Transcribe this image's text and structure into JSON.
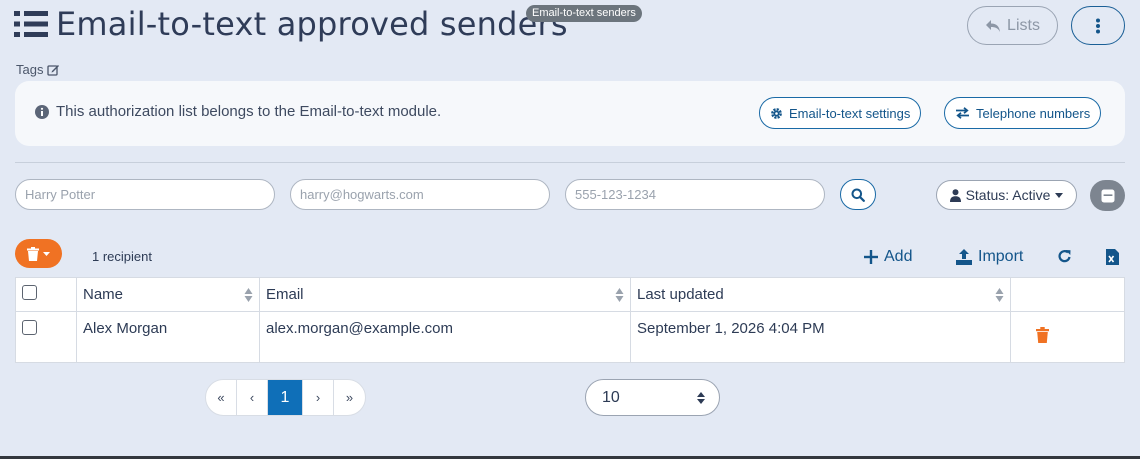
{
  "header": {
    "title": "Email-to-text approved senders",
    "module_badge": "Email-to-text senders",
    "lists_label": "Lists"
  },
  "tags_label": "Tags",
  "info": {
    "message": "This authorization list belongs to the Email-to-text module.",
    "settings_label": "Email-to-text settings",
    "numbers_label": "Telephone numbers"
  },
  "filters": {
    "name_placeholder": "Harry Potter",
    "email_placeholder": "harry@hogwarts.com",
    "phone_placeholder": "555-123-1234",
    "status_label": "Status: Active"
  },
  "toolbar": {
    "count": "1 recipient",
    "add_label": "Add",
    "import_label": "Import"
  },
  "table": {
    "headers": [
      "Name",
      "Email",
      "Last updated"
    ],
    "rows": [
      {
        "name": "Alex Morgan",
        "email": "alex.morgan@example.com",
        "updated": "September 1, 2026 4:04 PM"
      }
    ]
  },
  "pagination": {
    "first": "«",
    "prev": "‹",
    "current": "1",
    "next": "›",
    "last": "»",
    "per_page": "10"
  },
  "colors": {
    "accent": "#13558a",
    "danger": "#f07223",
    "page_active": "#0f6fb8"
  }
}
